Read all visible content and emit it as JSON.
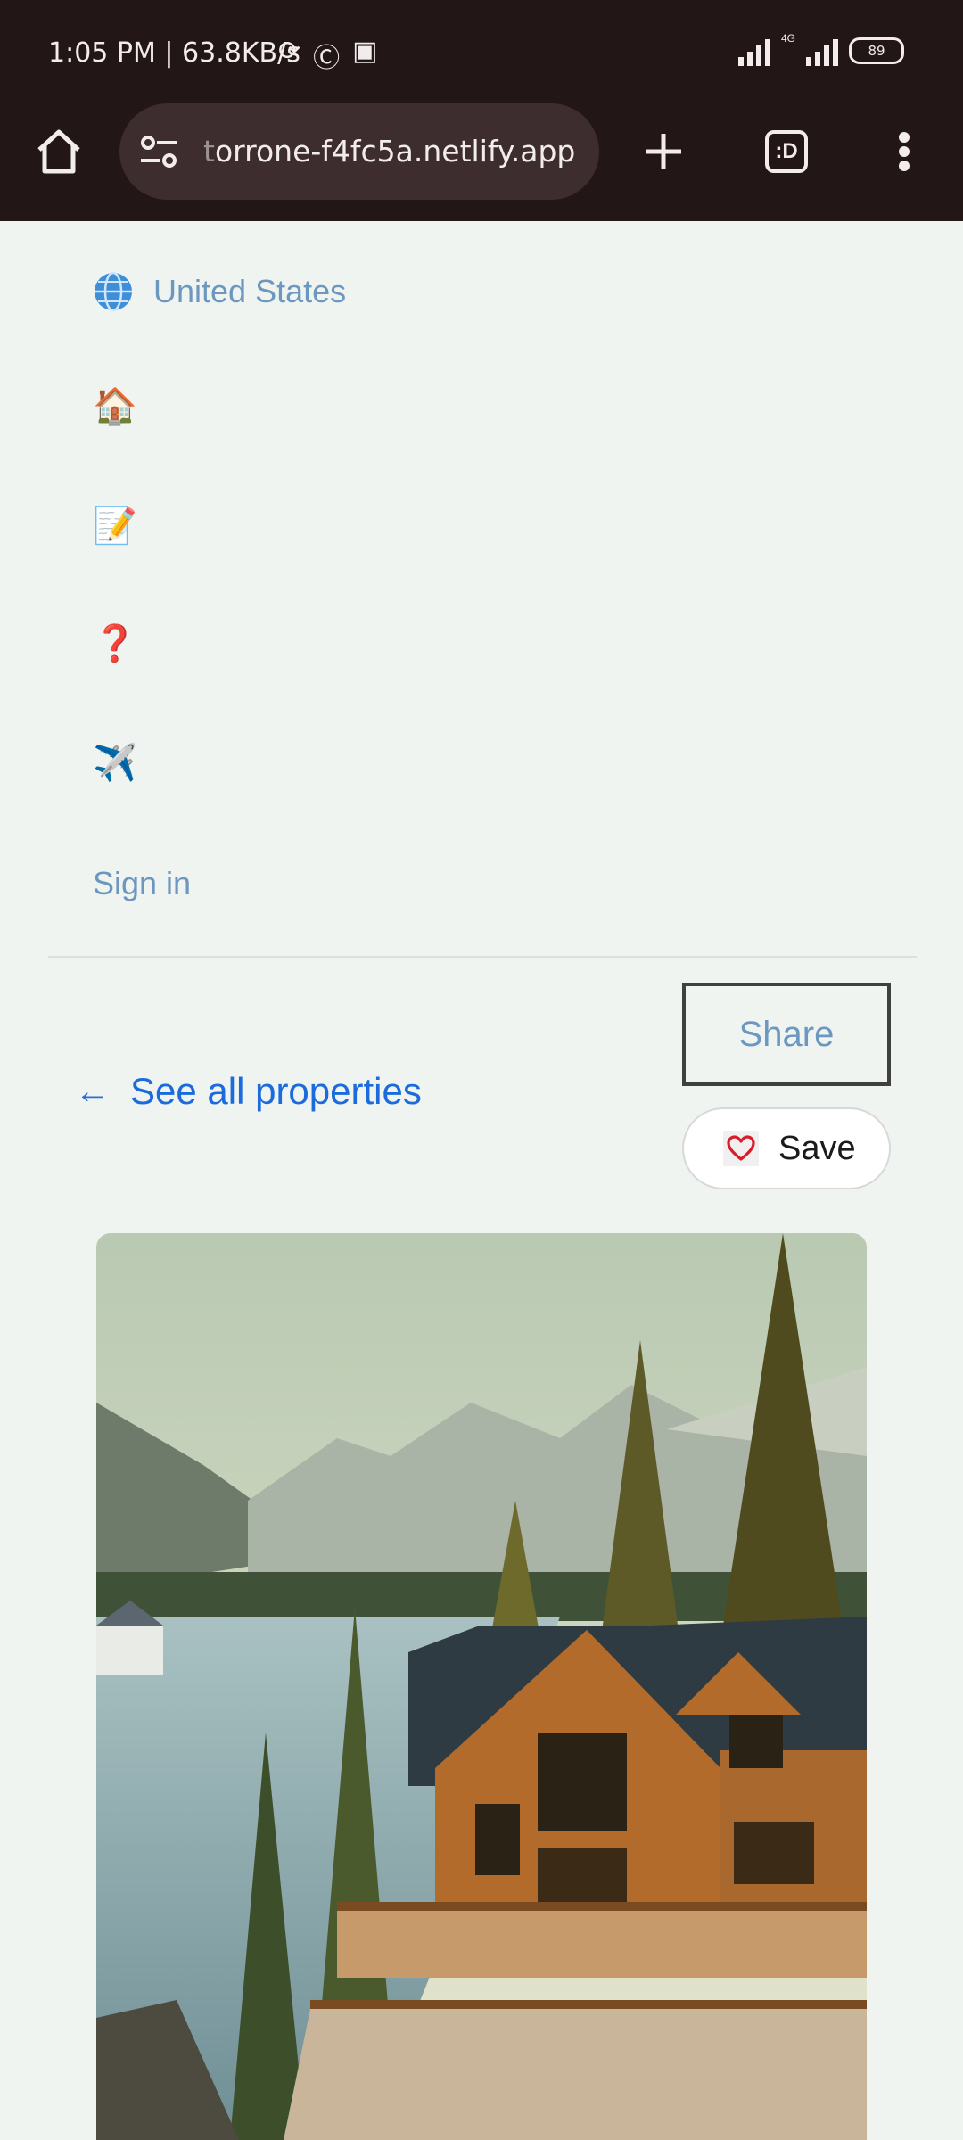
{
  "status_bar": {
    "time_speed": "1:05 PM | 63.8KB/s",
    "network": "4G",
    "battery": "89"
  },
  "browser": {
    "url_prefix": "t",
    "url_rest": "orrone-f4fc5a.netlify.app",
    "tab_icon_text": ":D"
  },
  "nav": {
    "language": "United States",
    "home_emoji": "🏠",
    "memo_emoji": "📝",
    "help_emoji": "❓",
    "plane_emoji": "✈️",
    "sign_in": "Sign in"
  },
  "property": {
    "back_arrow": "←",
    "back_label": "See all properties",
    "share_label": "Share",
    "save_label": "Save"
  },
  "colors": {
    "chrome_bg": "#221617",
    "page_bg": "#eff4f1",
    "link_blue": "#1c6bdc",
    "muted_blue": "#6c97bf",
    "heart_red": "#d91c2a"
  }
}
